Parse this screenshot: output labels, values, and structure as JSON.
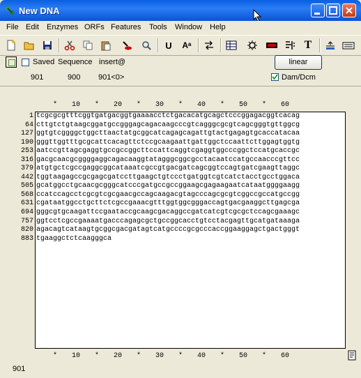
{
  "window": {
    "title": "New DNA"
  },
  "menu": [
    "File",
    "Edit",
    "Enzymes",
    "ORFs",
    "Features",
    "Tools",
    "Window",
    "Help"
  ],
  "options": {
    "saved_label": "Saved",
    "sequence_label": "Sequence",
    "insert_label": "insert@",
    "linear_label": "linear",
    "damdcm_label": "Dam/Dcm",
    "damdcm_checked": true,
    "saved_checked": false
  },
  "positions": {
    "p1": "901",
    "p2": "900",
    "p3": "901<0>"
  },
  "ruler": {
    "ticks": [
      "*",
      "10",
      "*",
      "20",
      "*",
      "30",
      "*",
      "40",
      "*",
      "50",
      "*",
      "60"
    ]
  },
  "sequence": {
    "line_numbers": [
      "1",
      "64",
      "127",
      "190",
      "253",
      "316",
      "379",
      "442",
      "505",
      "568",
      "631",
      "694",
      "757",
      "820",
      "883"
    ],
    "lines": [
      "tcgcgcgtttcggtgatgacggtgaaaacctctgacacatgcagctcccggagacggtcacag",
      "cttgtctgtaagcggatgccgggagcagacaagcccgtcagggcgcgtcagcgggtgttggcg",
      "ggtgtcggggctggcttaactatgcggcatcagagcagattgtactgagagtgcaccatacaa",
      "gggttggtttgcgcattcacagttctccgcaagaattgattggctccaattcttggagtggtg",
      "aatccgttagcgaggtgccgccggcttccattcaggtcgaggtggcccggctccatgcaccgc",
      "gacgcaacgcggggaggcagacaaggtatagggcggcgcctacaatccatgccaacccgttcc",
      "atgtgctcgccgaggcggcataaatcgccgtgacgatcagcggtccagtgatcgaagttaggc",
      "tggtaagagccgcgagcgatccttgaagctgtccctgatggtcgtcatctacctgcctggaca",
      "gcatggcctgcaacgcgggcatcccgatgccgccggaagcgagaagaatcataatggggaagg",
      "ccatccagcctcgcgtcgcgaacgccagcaagacgtagcccagcgcgtcggccgccatgccgg",
      "cgataatggcctgcttctcgccgaaacgtttggtggcgggaccagtgacgaaggcttgagcga",
      "gggcgtgcaagattccgaataccgcaagcgacaggccgatcatcgtcgcgctccagcgaaagc",
      "ggtcctcgccgaaaatgacccagagcgctgccggcacctgtcctacgagttgcatgataaaga",
      "agacagtcataagtgcggcgacgatagtcatgccccgcgcccaccggaaggagctgactgggt",
      "tgaaggctctcaagggca"
    ]
  },
  "status": {
    "position": "901"
  }
}
